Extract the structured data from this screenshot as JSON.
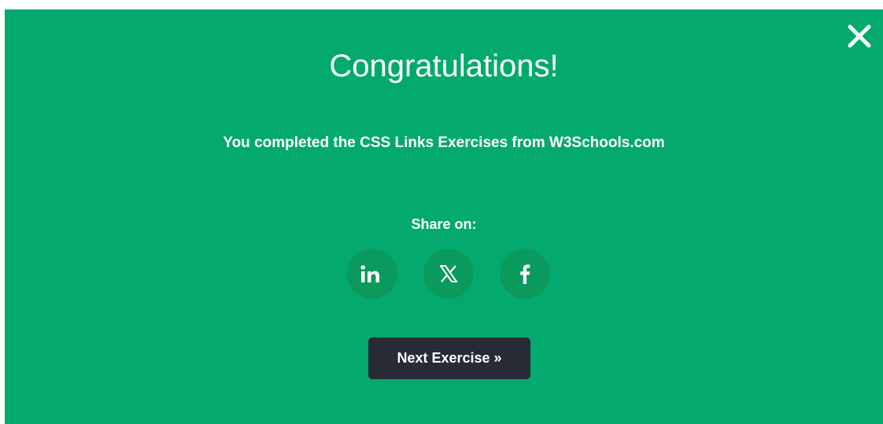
{
  "dialog": {
    "title": "Congratulations!",
    "message": "You completed the CSS Links Exercises from W3Schools.com",
    "share_label": "Share on:",
    "share_buttons": [
      {
        "icon": "linkedin-icon",
        "glyph": "in"
      },
      {
        "icon": "x-twitter-icon",
        "glyph": "𝕏"
      },
      {
        "icon": "facebook-icon",
        "glyph": "f"
      }
    ],
    "next_button_label": "Next Exercise »",
    "close_icon": "close-icon"
  },
  "colors": {
    "background": "#04AA6D",
    "share_button_bg": "#0B9A5E",
    "next_button_bg": "#282A35",
    "text": "#FFFFFF"
  }
}
